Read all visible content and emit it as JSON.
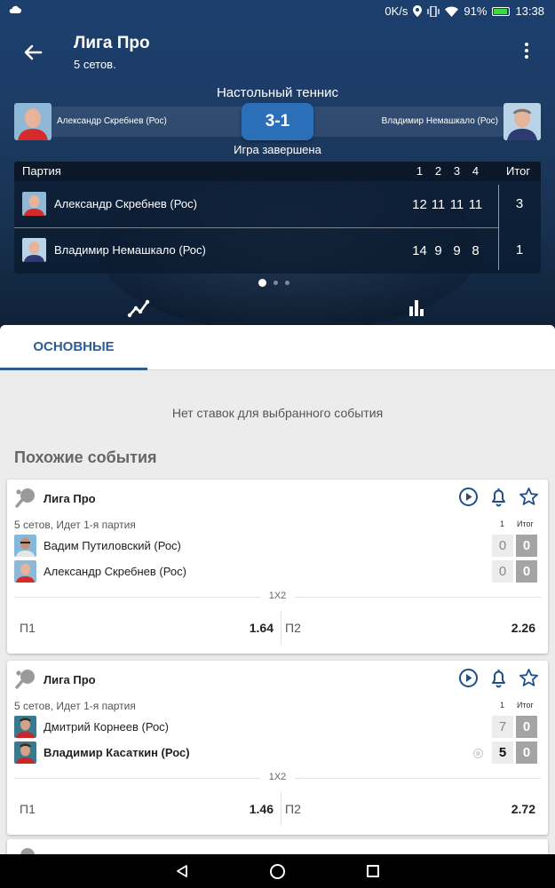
{
  "status_bar": {
    "speed": "0K/s",
    "battery": "91%",
    "time": "13:38"
  },
  "app_bar": {
    "title": "Лига Про",
    "subtitle": "5 сетов."
  },
  "match": {
    "sport": "Настольный теннис",
    "player1": "Александр Скребнев (Рос)",
    "player2": "Владимир Немашкало (Рос)",
    "score": "3-1",
    "status": "Игра завершена"
  },
  "score_table": {
    "header_label": "Партия",
    "set_headers": [
      "1",
      "2",
      "3",
      "4"
    ],
    "total_header": "Итог",
    "rows": [
      {
        "name": "Александр Скребнев (Рос)",
        "sets": [
          "12",
          "11",
          "11",
          "11"
        ],
        "total": "3"
      },
      {
        "name": "Владимир Немашкало (Рос)",
        "sets": [
          "14",
          "9",
          "9",
          "8"
        ],
        "total": "1"
      }
    ]
  },
  "tabs": {
    "main": "ОСНОВНЫЕ"
  },
  "no_bets_text": "Нет ставок для выбранного события",
  "similar_title": "Похожие события",
  "events": [
    {
      "league": "Лига Про",
      "info": "5 сетов, Идет 1-я партия",
      "col_set": "1",
      "col_total": "Итог",
      "players": [
        {
          "name": "Вадим Путиловский (Рос)",
          "set": "0",
          "total": "0"
        },
        {
          "name": "Александр Скребнев (Рос)",
          "set": "0",
          "total": "0"
        }
      ],
      "market": "1X2",
      "odds": [
        {
          "label": "П1",
          "value": "1.64"
        },
        {
          "label": "П2",
          "value": "2.26"
        }
      ]
    },
    {
      "league": "Лига Про",
      "info": "5 сетов, Идет 1-я партия",
      "col_set": "1",
      "col_total": "Итог",
      "players": [
        {
          "name": "Дмитрий Корнеев (Рос)",
          "set": "7",
          "total": "0"
        },
        {
          "name": "Владимир Касаткин (Рос)",
          "set": "5",
          "total": "0"
        }
      ],
      "market": "1X2",
      "odds": [
        {
          "label": "П1",
          "value": "1.46"
        },
        {
          "label": "П2",
          "value": "2.72"
        }
      ]
    }
  ],
  "colors": {
    "header_bg": "#1c3f6e",
    "accent": "#2c5d94",
    "score_box": "#2a6fb8",
    "icon_blue": "#1f4f86"
  },
  "icons": [
    "back-arrow-icon",
    "more-vert-icon",
    "line-chart-icon",
    "bar-chart-icon",
    "play-icon",
    "bell-icon",
    "star-icon",
    "table-tennis-icon"
  ]
}
